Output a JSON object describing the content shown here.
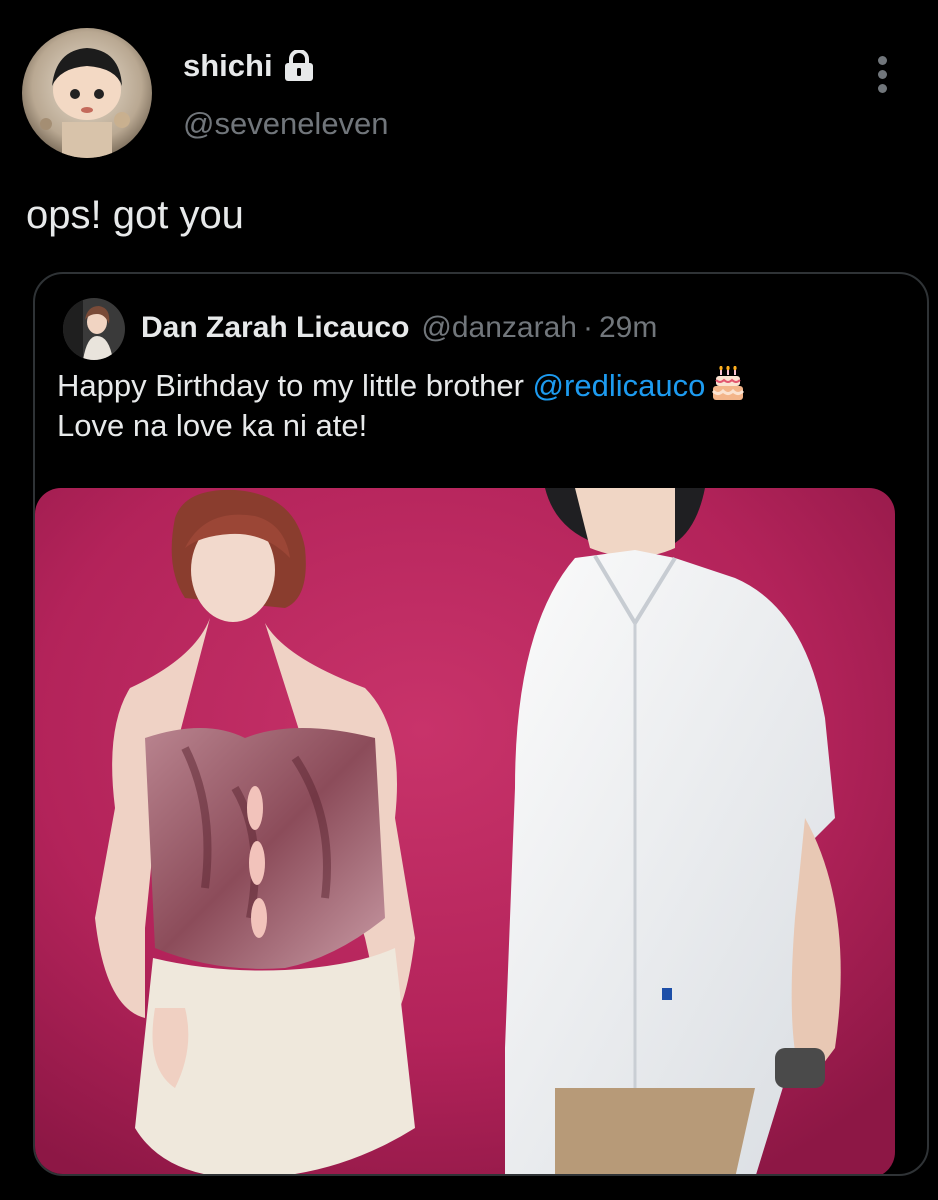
{
  "author": {
    "display_name": "shichi",
    "handle": "@seveneleven",
    "protected_icon": "lock-icon"
  },
  "tweet": {
    "text": "ops! got you"
  },
  "menu": {
    "icon": "more-vertical-icon"
  },
  "quoted": {
    "display_name": "Dan Zarah Licauco",
    "handle": "@danzarah",
    "separator": "·",
    "time": "29m",
    "text_before": "Happy Birthday to my little brother ",
    "mention": "@redlicauco",
    "emoji": "birthday-cake-icon",
    "text_line2": "Love na love ka ni ate!",
    "media": "photo"
  },
  "colors": {
    "background": "#000000",
    "text_primary": "#e7e9ea",
    "text_secondary": "#71767b",
    "link": "#1d9bf0",
    "border": "#2f3336",
    "photo_backdrop": "#b8245a"
  }
}
